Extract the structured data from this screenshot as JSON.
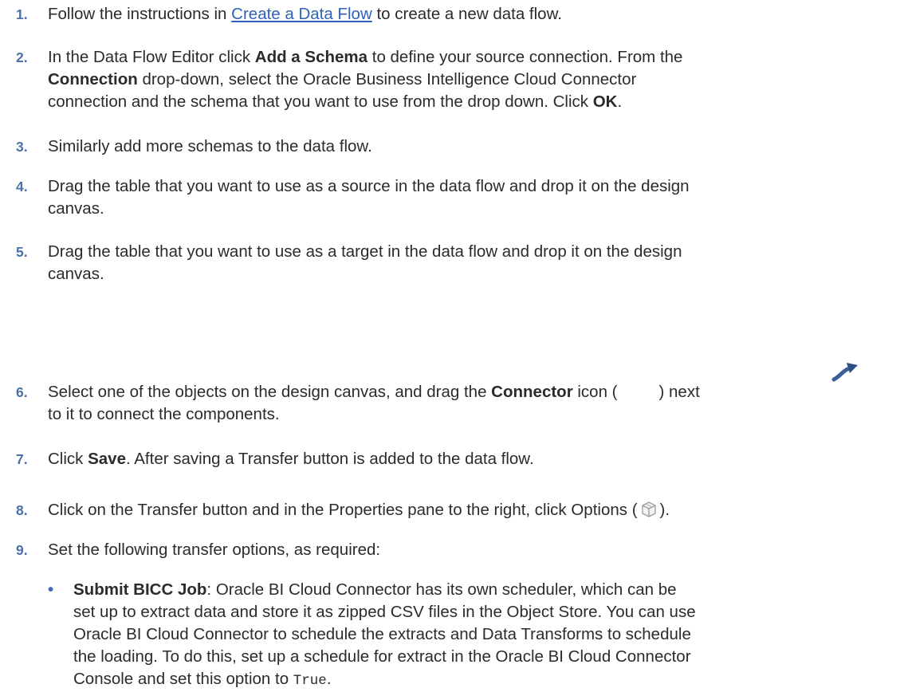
{
  "steps": [
    {
      "num": "1.",
      "p1": "Follow the instructions in ",
      "link": "Create a Data Flow",
      "p2": " to create a new data flow."
    },
    {
      "num": "2.",
      "p1": "In the Data Flow Editor click ",
      "b1": "Add a Schema",
      "p2": " to define your source connection. From the ",
      "b2": "Connection",
      "p3": " drop-down, select the Oracle Business Intelligence Cloud Connector",
      "p4": "connection and the schema that you want to use from the drop down. Click ",
      "b3": "OK",
      "p5": "."
    },
    {
      "num": "3.",
      "p1": "Similarly add more schemas to the data flow."
    },
    {
      "num": "4.",
      "p1": "Drag the table that you want to use as a source in the data flow and drop it on the design",
      "p2": "canvas."
    },
    {
      "num": "5.",
      "p1": "Drag the table that you want to use as a target in the data flow and drop it on the design",
      "p2": "canvas."
    },
    {
      "num": "6.",
      "p1": "Select one of the objects on the design canvas, and drag the ",
      "b1": "Connector",
      "p2": " icon (",
      "p3": ") next",
      "p4": "to it to connect the components."
    },
    {
      "num": "7.",
      "p1": "Click ",
      "b1": "Save",
      "p2": ". After saving a Transfer button is added to the data flow."
    },
    {
      "num": "8.",
      "p1": "Click on the Transfer button and in the Properties pane to the right, click Options (",
      "p2": ")."
    },
    {
      "num": "9.",
      "p1": "Set the following transfer options, as required:"
    }
  ],
  "bullets": [
    {
      "mark": "•",
      "b1": "Submit BICC Job",
      "l1": ": Oracle BI Cloud Connector has its own scheduler, which can be",
      "l2": "set up to extract data and store it as zipped CSV files in the Object Store. You can use",
      "l3": "Oracle BI Cloud Connector to schedule the extracts and Data Transforms to schedule",
      "l4": "the loading. To do this, set up a schedule for extract in the Oracle BI Cloud Connector",
      "l5": "Console and set this option to ",
      "code": "True",
      "l6": "."
    }
  ],
  "colors": {
    "step_number": "#4a71a8",
    "link": "#2e62bd",
    "body_text": "#2b2b2b"
  },
  "icons": {
    "connector": "connector-arrow-icon",
    "options": "options-cube-icon"
  }
}
